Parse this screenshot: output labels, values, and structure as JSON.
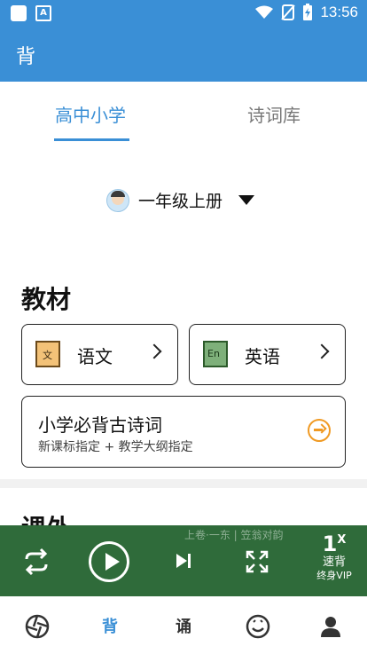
{
  "status_bar": {
    "time": "13:56",
    "left_icons": [
      "square-icon",
      "a-icon"
    ],
    "right_icons": [
      "wifi-icon",
      "no-sim-icon",
      "battery-charging-icon"
    ]
  },
  "app_bar": {
    "title": "背"
  },
  "tabs": [
    {
      "label": "高中小学",
      "active": true
    },
    {
      "label": "诗词库",
      "active": false
    }
  ],
  "grade_selector": {
    "label": "一年级上册"
  },
  "textbook_section": {
    "title": "教材"
  },
  "cards": {
    "chinese": {
      "icon_text": "文",
      "label": "语文"
    },
    "english": {
      "icon_text": "En",
      "label": "英语"
    },
    "must_recite": {
      "title": "小学必背古诗词",
      "subtitle": "新课标指定 + 教学大纲指定"
    }
  },
  "extracurricular_section": {
    "title": "课外"
  },
  "player": {
    "now_playing": "上卷·一东 | 笠翁对韵",
    "speed_value": "1",
    "speed_suffix": "X",
    "speed_label": "速背",
    "vip_label": "终身VIP"
  },
  "bottom_nav": [
    {
      "icon": "aperture-icon",
      "label": ""
    },
    {
      "label": "背",
      "active": true
    },
    {
      "label": "诵",
      "active": false
    },
    {
      "icon": "smile-icon",
      "label": ""
    },
    {
      "icon": "person-icon",
      "label": ""
    }
  ],
  "colors": {
    "primary": "#3a8fd6",
    "player_bg": "#2f6b3a",
    "accent_orange": "#f09a23"
  }
}
